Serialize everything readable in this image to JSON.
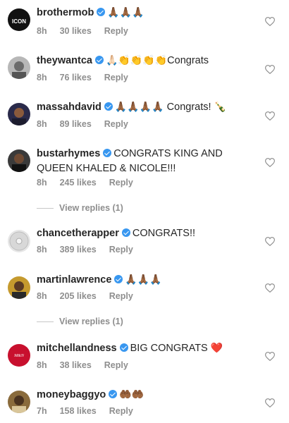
{
  "comments": [
    {
      "username": "brothermob",
      "text": "",
      "emoji": "🙏🏾🙏🏾🙏🏾",
      "time": "8h",
      "likes": "30 likes",
      "reply": "Reply"
    },
    {
      "username": "theywantca",
      "text": "Congrats",
      "emoji": "🙏🏻👏👏👏👏",
      "time": "8h",
      "likes": "76 likes",
      "reply": "Reply"
    },
    {
      "username": "massahdavid",
      "text": "Congrats!",
      "emoji": "🙏🏾🙏🏾🙏🏾🙏🏾",
      "emoji_after": "🍾",
      "time": "8h",
      "likes": "89 likes",
      "reply": "Reply"
    },
    {
      "username": "bustarhymes",
      "text": "CONGRATS KING AND QUEEN KHALED & NICOLE!!!",
      "time": "8h",
      "likes": "245 likes",
      "reply": "Reply",
      "view_replies": "View replies (1)"
    },
    {
      "username": "chancetherapper",
      "text": "CONGRATS!!",
      "time": "8h",
      "likes": "389 likes",
      "reply": "Reply"
    },
    {
      "username": "martinlawrence",
      "text": "",
      "emoji": "🙏🏾🙏🏾🙏🏾",
      "time": "8h",
      "likes": "205 likes",
      "reply": "Reply",
      "view_replies": "View replies (1)"
    },
    {
      "username": "mitchellandness",
      "text": "BIG CONGRATS",
      "emoji_after": "❤️",
      "time": "8h",
      "likes": "38 likes",
      "reply": "Reply"
    },
    {
      "username": "moneybaggyo",
      "text": "",
      "emoji": "🤲🏾🤲🏾",
      "time": "7h",
      "likes": "158 likes",
      "reply": "Reply"
    }
  ],
  "colors": {
    "verified": "#3897f0",
    "meta": "#8e8e8e",
    "text": "#262626"
  },
  "icons": {
    "verified": "verified-badge-icon",
    "like": "heart-outline-icon"
  }
}
